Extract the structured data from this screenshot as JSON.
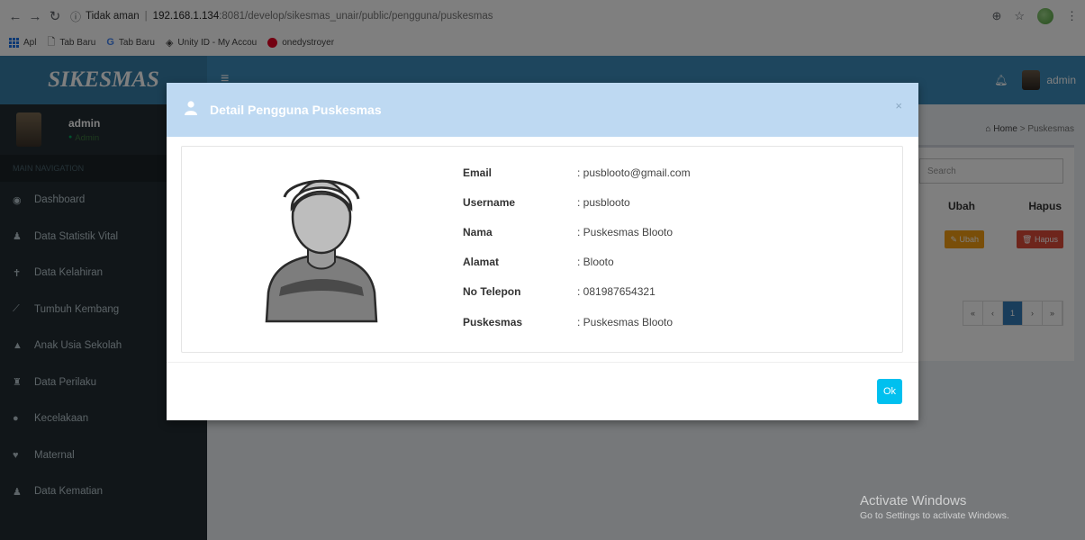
{
  "browser": {
    "security_label": "Tidak aman",
    "url_host": "192.168.1.134",
    "url_rest": ":8081/develop/sikesmas_unair/public/pengguna/puskesmas",
    "bookmarks": [
      "Apl",
      "Tab Baru",
      "Tab Baru",
      "Unity ID - My Accou",
      "onedystroyer"
    ]
  },
  "app": {
    "logo": "SIKESMAS",
    "nav_user": "admin"
  },
  "sidebar": {
    "user_name": "admin",
    "user_role": "Admin",
    "menu_header": "MAIN NAVIGATION",
    "items": [
      {
        "label": "Dashboard",
        "icon": "dashboard-icon",
        "glyph": "◉"
      },
      {
        "label": "Data Statistik Vital",
        "icon": "user-icon",
        "glyph": "♟"
      },
      {
        "label": "Data Kelahiran",
        "icon": "child-icon",
        "glyph": "✝"
      },
      {
        "label": "Tumbuh Kembang",
        "icon": "chart-line-icon",
        "glyph": "⟋"
      },
      {
        "label": "Anak Usia Sekolah",
        "icon": "graduation-cap-icon",
        "glyph": "▲"
      },
      {
        "label": "Data Perilaku",
        "icon": "binoculars-icon",
        "glyph": "♜"
      },
      {
        "label": "Kecelakaan",
        "icon": "alert-icon",
        "glyph": "●"
      },
      {
        "label": "Maternal",
        "icon": "heart-icon",
        "glyph": "♥"
      },
      {
        "label": "Data Kematian",
        "icon": "users-icon",
        "glyph": "♟"
      }
    ]
  },
  "content": {
    "breadcrumb_home": "Home",
    "breadcrumb_current": "Puskesmas",
    "search_placeholder": "Search",
    "col_ubah": "Ubah",
    "col_hapus": "Hapus",
    "btn_ubah": "Ubah",
    "btn_hapus": "Hapus",
    "pager": [
      "«",
      "‹",
      "1",
      "›",
      "»"
    ]
  },
  "modal": {
    "title": "Detail Pengguna Puskesmas",
    "ok_label": "Ok",
    "fields": [
      {
        "label": "Email",
        "value": ": pusblooto@gmail.com"
      },
      {
        "label": "Username",
        "value": ": pusblooto"
      },
      {
        "label": "Nama",
        "value": ": Puskesmas Blooto"
      },
      {
        "label": "Alamat",
        "value": ": Blooto"
      },
      {
        "label": "No Telepon",
        "value": ": 081987654321"
      },
      {
        "label": "Puskesmas",
        "value": ": Puskesmas Blooto"
      }
    ]
  },
  "watermark": {
    "line1": "Activate Windows",
    "line2": "Go to Settings to activate Windows."
  }
}
